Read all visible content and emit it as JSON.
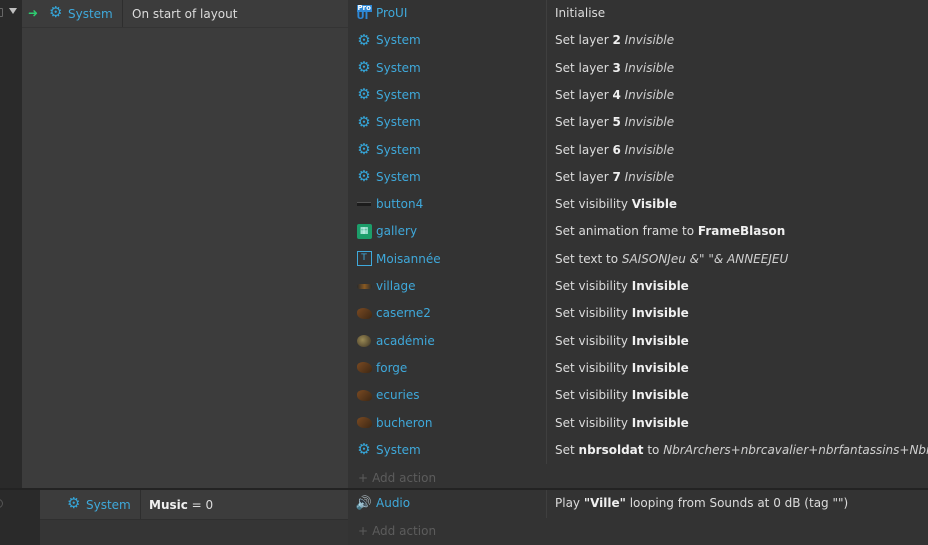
{
  "event1": {
    "condition_object": "System",
    "condition_text": "On start of layout",
    "actions": [
      {
        "icon": "pro-ui-icon",
        "object": "ProUI",
        "desc": [
          {
            "t": "Initialise"
          }
        ]
      },
      {
        "icon": "gear-icon",
        "object": "System",
        "desc": [
          {
            "t": "Set layer "
          },
          {
            "t": "2",
            "s": "b"
          },
          {
            "t": " "
          },
          {
            "t": "Invisible",
            "s": "i"
          }
        ]
      },
      {
        "icon": "gear-icon",
        "object": "System",
        "desc": [
          {
            "t": "Set layer "
          },
          {
            "t": "3",
            "s": "b"
          },
          {
            "t": " "
          },
          {
            "t": "Invisible",
            "s": "i"
          }
        ]
      },
      {
        "icon": "gear-icon",
        "object": "System",
        "desc": [
          {
            "t": "Set layer "
          },
          {
            "t": "4",
            "s": "b"
          },
          {
            "t": " "
          },
          {
            "t": "Invisible",
            "s": "i"
          }
        ]
      },
      {
        "icon": "gear-icon",
        "object": "System",
        "desc": [
          {
            "t": "Set layer "
          },
          {
            "t": "5",
            "s": "b"
          },
          {
            "t": " "
          },
          {
            "t": "Invisible",
            "s": "i"
          }
        ]
      },
      {
        "icon": "gear-icon",
        "object": "System",
        "desc": [
          {
            "t": "Set layer "
          },
          {
            "t": "6",
            "s": "b"
          },
          {
            "t": " "
          },
          {
            "t": "Invisible",
            "s": "i"
          }
        ]
      },
      {
        "icon": "gear-icon",
        "object": "System",
        "desc": [
          {
            "t": "Set layer "
          },
          {
            "t": "7",
            "s": "b"
          },
          {
            "t": " "
          },
          {
            "t": "Invisible",
            "s": "i"
          }
        ]
      },
      {
        "icon": "button-icon",
        "object": "button4",
        "desc": [
          {
            "t": "Set visibility "
          },
          {
            "t": "Visible",
            "s": "b"
          }
        ]
      },
      {
        "icon": "gallery-icon",
        "object": "gallery",
        "desc": [
          {
            "t": "Set animation frame to "
          },
          {
            "t": "FrameBlason",
            "s": "b"
          }
        ]
      },
      {
        "icon": "text-icon",
        "object": "Moisannée",
        "desc": [
          {
            "t": "Set text to "
          },
          {
            "t": "SAISONJeu &\" \"& ANNEEJEU",
            "s": "i"
          }
        ]
      },
      {
        "icon": "village-icon",
        "object": "village",
        "desc": [
          {
            "t": "Set visibility "
          },
          {
            "t": "Invisible",
            "s": "b"
          }
        ]
      },
      {
        "icon": "caserne-icon",
        "object": "caserne2",
        "desc": [
          {
            "t": "Set visibility "
          },
          {
            "t": "Invisible",
            "s": "b"
          }
        ]
      },
      {
        "icon": "academie-icon",
        "object": "académie",
        "desc": [
          {
            "t": "Set visibility "
          },
          {
            "t": "Invisible",
            "s": "b"
          }
        ]
      },
      {
        "icon": "forge-icon",
        "object": "forge",
        "desc": [
          {
            "t": "Set visibility "
          },
          {
            "t": "Invisible",
            "s": "b"
          }
        ]
      },
      {
        "icon": "ecuries-icon",
        "object": "ecuries",
        "desc": [
          {
            "t": "Set visibility "
          },
          {
            "t": "Invisible",
            "s": "b"
          }
        ]
      },
      {
        "icon": "bucheron-icon",
        "object": "bucheron",
        "desc": [
          {
            "t": "Set visibility "
          },
          {
            "t": "Invisible",
            "s": "b"
          }
        ]
      },
      {
        "icon": "gear-icon",
        "object": "System",
        "desc": [
          {
            "t": "Set "
          },
          {
            "t": "nbrsoldat",
            "s": "b"
          },
          {
            "t": " to "
          },
          {
            "t": "NbrArchers+nbrcavalier+nbrfantassins+NbrPiquier",
            "s": "i"
          }
        ]
      }
    ],
    "add_action": "Add action"
  },
  "event2": {
    "condition_object": "System",
    "condition_text_bold": "Music",
    "condition_text_rest": " = 0",
    "actions": [
      {
        "icon": "audio-icon",
        "object": "Audio",
        "desc": [
          {
            "t": "Play "
          },
          {
            "t": "\"Ville\"",
            "s": "b"
          },
          {
            "t": " looping from Sounds at 0 dB (tag \"\")"
          }
        ]
      }
    ],
    "add_action": "Add action"
  },
  "colors": {
    "accent": "#3fa9db",
    "trigger_arrow": "#2ecc71",
    "background": "#2f2f2f",
    "condition_bg": "#3c3c3c",
    "actions_bg": "#333333"
  }
}
